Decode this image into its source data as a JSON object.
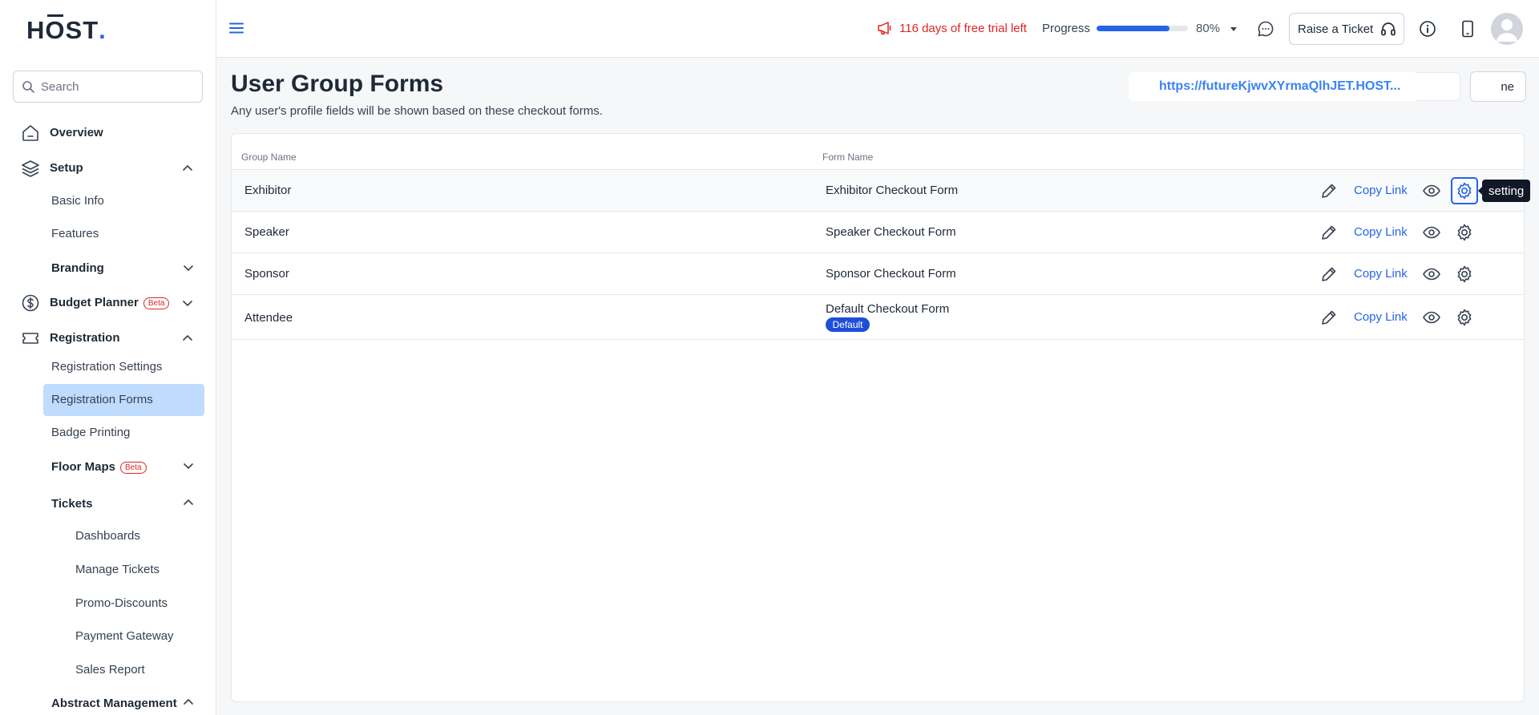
{
  "brand": {
    "logo_prefix": "H",
    "logo_o": "O",
    "logo_suffix": "ST",
    "logo_dot": ".",
    "accent": "#2563eb"
  },
  "sidebar": {
    "search_placeholder": "Search",
    "overview": "Overview",
    "setup": "Setup",
    "basic_info": "Basic Info",
    "features": "Features",
    "branding": "Branding",
    "budget_planner": "Budget Planner",
    "beta": "Beta",
    "registration": "Registration",
    "registration_settings": "Registration Settings",
    "registration_forms": "Registration Forms",
    "badge_printing": "Badge Printing",
    "floor_maps": "Floor Maps",
    "tickets": "Tickets",
    "dashboards": "Dashboards",
    "manage_tickets": "Manage Tickets",
    "promo_discounts": "Promo-Discounts",
    "payment_gateway": "Payment Gateway",
    "sales_report": "Sales Report",
    "abstract_management": "Abstract Management"
  },
  "topbar": {
    "trial": "116 days of free trial left",
    "progress_label": "Progress",
    "progress_value": 0.8,
    "progress_pct": "80%",
    "raise_ticket": "Raise a Ticket"
  },
  "page": {
    "title": "User Group Forms",
    "subtitle": "Any user's profile fields will be shown based on these checkout forms.",
    "url": "https://futureKjwvXYrmaQlhJET.HOST...",
    "ne_button": "ne"
  },
  "table": {
    "headers": {
      "group": "Group Name",
      "form": "Form Name"
    },
    "copy_label": "Copy Link",
    "default_badge": "Default",
    "rows": [
      {
        "group": "Exhibitor",
        "form": "Exhibitor Checkout Form"
      },
      {
        "group": "Speaker",
        "form": "Speaker Checkout Form"
      },
      {
        "group": "Sponsor",
        "form": "Sponsor Checkout Form"
      },
      {
        "group": "Attendee",
        "form": "Default Checkout Form"
      }
    ]
  },
  "tooltip": "setting"
}
